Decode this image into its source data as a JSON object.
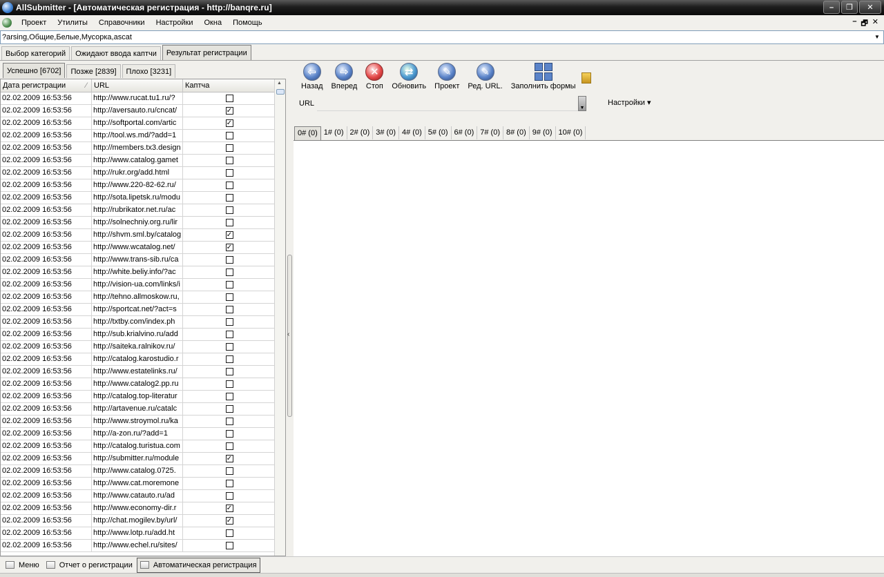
{
  "window": {
    "title": "AllSubmitter - [Автоматическая регистрация - http://banqre.ru]"
  },
  "menu": [
    "Проект",
    "Утилиты",
    "Справочники",
    "Настройки",
    "Окна",
    "Помощь"
  ],
  "mdi_controls": [
    "–",
    "🗗",
    "✕"
  ],
  "project_combo": "?arsing,Общие,Белые,Мусорка,ascat",
  "main_tabs": [
    "Выбор категорий",
    "Ожидают ввода каптчи",
    "Результат регистрации"
  ],
  "sub_tabs": [
    "Успешно [6702]",
    "Позже [2839]",
    "Плохо [3231]"
  ],
  "grid": {
    "columns": [
      "Дата регистрации",
      "URL",
      "Каптча"
    ],
    "rows": [
      {
        "date": "02.02.2009 16:53:56",
        "url": "http://www.rucat.tu1.ru/?",
        "captcha": false
      },
      {
        "date": "02.02.2009 16:53:56",
        "url": "http://aversauto.ru/cncat/",
        "captcha": true
      },
      {
        "date": "02.02.2009 16:53:56",
        "url": "http://softportal.com/artic",
        "captcha": true
      },
      {
        "date": "02.02.2009 16:53:56",
        "url": "http://tool.ws.md/?add=1",
        "captcha": false
      },
      {
        "date": "02.02.2009 16:53:56",
        "url": "http://members.tx3.design",
        "captcha": false
      },
      {
        "date": "02.02.2009 16:53:56",
        "url": "http://www.catalog.gamet",
        "captcha": false
      },
      {
        "date": "02.02.2009 16:53:56",
        "url": "http://rukr.org/add.html",
        "captcha": false
      },
      {
        "date": "02.02.2009 16:53:56",
        "url": "http://www.220-82-62.ru/",
        "captcha": false
      },
      {
        "date": "02.02.2009 16:53:56",
        "url": "http://sota.lipetsk.ru/modu",
        "captcha": false
      },
      {
        "date": "02.02.2009 16:53:56",
        "url": "http://rubrikator.net.ru/ac",
        "captcha": false
      },
      {
        "date": "02.02.2009 16:53:56",
        "url": "http://solnechniy.org.ru/lir",
        "captcha": false
      },
      {
        "date": "02.02.2009 16:53:56",
        "url": "http://shvm.sml.by/catalog",
        "captcha": true
      },
      {
        "date": "02.02.2009 16:53:56",
        "url": "http://www.wcatalog.net/",
        "captcha": true
      },
      {
        "date": "02.02.2009 16:53:56",
        "url": "http://www.trans-sib.ru/ca",
        "captcha": false
      },
      {
        "date": "02.02.2009 16:53:56",
        "url": "http://white.beliy.info/?ac",
        "captcha": false
      },
      {
        "date": "02.02.2009 16:53:56",
        "url": "http://vision-ua.com/links/i",
        "captcha": false
      },
      {
        "date": "02.02.2009 16:53:56",
        "url": "http://tehno.allmoskow.ru,",
        "captcha": false
      },
      {
        "date": "02.02.2009 16:53:56",
        "url": "http://sportcat.net/?act=s",
        "captcha": false
      },
      {
        "date": "02.02.2009 16:53:56",
        "url": "http://txtby.com/index.ph",
        "captcha": false
      },
      {
        "date": "02.02.2009 16:53:56",
        "url": "http://sub.krialvino.ru/add",
        "captcha": false
      },
      {
        "date": "02.02.2009 16:53:56",
        "url": "http://saiteka.ralnikov.ru/",
        "captcha": false
      },
      {
        "date": "02.02.2009 16:53:56",
        "url": "http://catalog.karostudio.r",
        "captcha": false
      },
      {
        "date": "02.02.2009 16:53:56",
        "url": "http://www.estatelinks.ru/",
        "captcha": false
      },
      {
        "date": "02.02.2009 16:53:56",
        "url": "http://www.catalog2.pp.ru",
        "captcha": false
      },
      {
        "date": "02.02.2009 16:53:56",
        "url": "http://catalog.top-literatur",
        "captcha": false
      },
      {
        "date": "02.02.2009 16:53:56",
        "url": "http://artavenue.ru/catalc",
        "captcha": false
      },
      {
        "date": "02.02.2009 16:53:56",
        "url": "http://www.stroymol.ru/ka",
        "captcha": false
      },
      {
        "date": "02.02.2009 16:53:56",
        "url": "http://a-zon.ru/?add=1",
        "captcha": false
      },
      {
        "date": "02.02.2009 16:53:56",
        "url": "http://catalog.turistua.com",
        "captcha": false
      },
      {
        "date": "02.02.2009 16:53:56",
        "url": "http://submitter.ru/module",
        "captcha": true
      },
      {
        "date": "02.02.2009 16:53:56",
        "url": "http://www.catalog.0725.",
        "captcha": false
      },
      {
        "date": "02.02.2009 16:53:56",
        "url": "http://www.cat.moremone",
        "captcha": false
      },
      {
        "date": "02.02.2009 16:53:56",
        "url": "http://www.catauto.ru/ad",
        "captcha": false
      },
      {
        "date": "02.02.2009 16:53:56",
        "url": "http://www.economy-dir.r",
        "captcha": true
      },
      {
        "date": "02.02.2009 16:53:56",
        "url": "http://chat.mogilev.by/url/",
        "captcha": true
      },
      {
        "date": "02.02.2009 16:53:56",
        "url": "http://www.lotp.ru/add.ht",
        "captcha": false
      },
      {
        "date": "02.02.2009 16:53:56",
        "url": "http://www.echel.ru/sites/",
        "captcha": false
      }
    ]
  },
  "toolbar": {
    "back": "Назад",
    "forward": "Вперед",
    "stop": "Стоп",
    "refresh": "Обновить",
    "project": "Проект",
    "edit_url": "Ред. URL.",
    "fill_forms": "Заполнить формы",
    "url_label": "URL",
    "url_value": "",
    "settings": "Настройки ▾"
  },
  "page_tabs": [
    "0# (0)",
    "1# (0)",
    "2# (0)",
    "3# (0)",
    "4# (0)",
    "5# (0)",
    "6# (0)",
    "7# (0)",
    "8# (0)",
    "9# (0)",
    "10# (0)"
  ],
  "taskbar": [
    "Меню",
    "Отчет о регистрации",
    "Автоматическая регистрация"
  ]
}
